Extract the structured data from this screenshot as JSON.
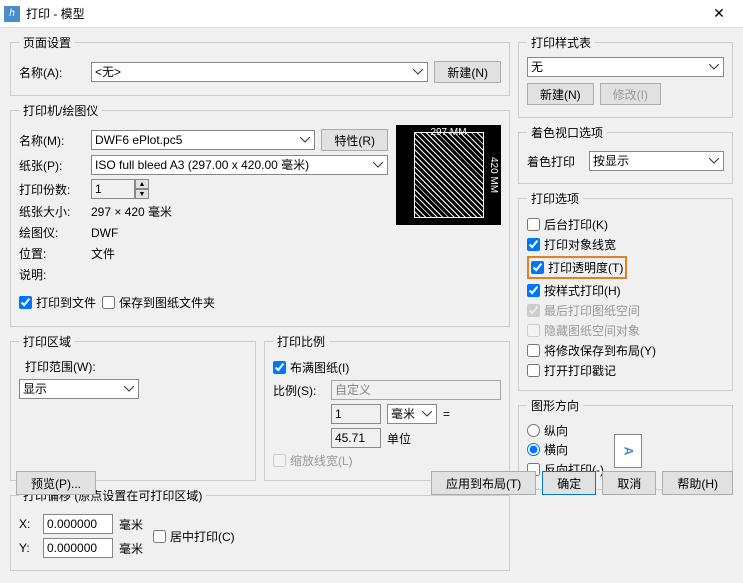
{
  "window": {
    "title": "打印 - 模型"
  },
  "pageSetup": {
    "legend": "页面设置",
    "nameLabel": "名称(A):",
    "nameValue": "<无>",
    "newBtn": "新建(N)"
  },
  "printer": {
    "legend": "打印机/绘图仪",
    "nameLabel": "名称(M):",
    "nameValue": "DWF6 ePlot.pc5",
    "propsBtn": "特性(R)",
    "paperLabel": "纸张(P):",
    "paperValue": "ISO full bleed A3 (297.00 x 420.00 毫米)",
    "copiesLabel": "打印份数:",
    "copiesValue": "1",
    "sizeLabel": "纸张大小:",
    "sizeValue": "297 × 420  毫米",
    "plotterLabel": "绘图仪:",
    "plotterValue": "DWF",
    "locationLabel": "位置:",
    "locationValue": "文件",
    "descLabel": "说明:",
    "previewTop": "297 MM",
    "previewRight": "420 MM",
    "toFile": "打印到文件",
    "saveToFolder": "保存到图纸文件夹"
  },
  "plotArea": {
    "legend": "打印区域",
    "rangeLabel": "打印范围(W):",
    "rangeValue": "显示"
  },
  "plotScale": {
    "legend": "打印比例",
    "fit": "布满图纸(I)",
    "scaleLabel": "比例(S):",
    "scaleValue": "自定义",
    "unit1": "1",
    "unitSel": "毫米",
    "eq": "=",
    "unit2": "45.71",
    "unitText": "单位",
    "scaleLW": "缩放线宽(L)"
  },
  "offset": {
    "legend": "打印偏移 (原点设置在可打印区域)",
    "xLabel": "X:",
    "xValue": "0.000000",
    "yLabel": "Y:",
    "yValue": "0.000000",
    "unit": "毫米",
    "center": "居中打印(C)"
  },
  "styleTable": {
    "legend": "打印样式表",
    "value": "无",
    "newBtn": "新建(N)",
    "editBtn": "修改(I)"
  },
  "shadeVP": {
    "legend": "着色视口选项",
    "label": "着色打印",
    "value": "按显示"
  },
  "options": {
    "legend": "打印选项",
    "bg": "后台打印(K)",
    "lw": "打印对象线宽",
    "trans": "打印透明度(T)",
    "style": "按样式打印(H)",
    "last": "最后打印图纸空间",
    "hide": "隐藏图纸空间对象",
    "save": "将修改保存到布局(Y)",
    "stamp": "打开打印戳记"
  },
  "orient": {
    "legend": "图形方向",
    "portrait": "纵向",
    "landscape": "横向",
    "reverse": "反向打印(-)",
    "glyph": "A"
  },
  "buttons": {
    "preview": "预览(P)...",
    "applyLayout": "应用到布局(T)",
    "ok": "确定",
    "cancel": "取消",
    "help": "帮助(H)"
  }
}
